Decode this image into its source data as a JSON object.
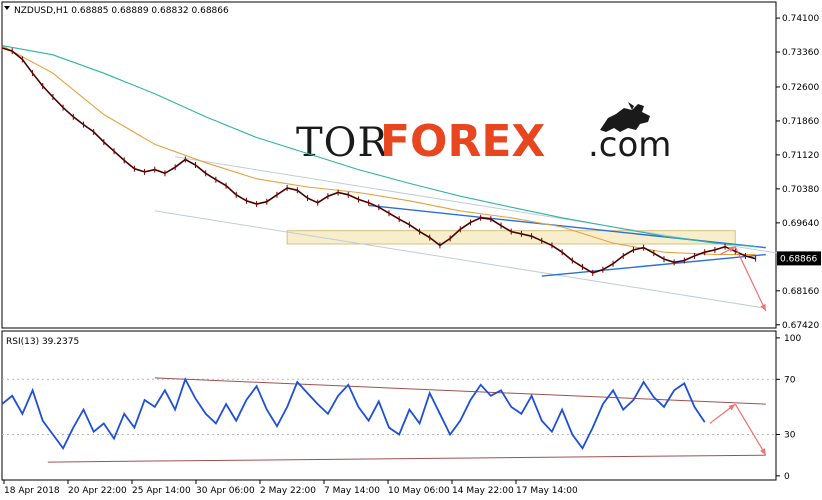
{
  "chart_data": [
    {
      "type": "line",
      "title": "NZDUSD,H1  0.68885 0.68889 0.68832 0.68866",
      "y_ticks": [
        "0.74100",
        "0.73360",
        "0.72600",
        "0.71860",
        "0.71120",
        "0.70380",
        "0.69640",
        "0.68866",
        "0.68160",
        "0.67420"
      ],
      "ylim": [
        0.6735,
        0.7445
      ],
      "current_price": "0.68866",
      "x_labels": [
        "18 Apr 2018",
        "20 Apr 22:00",
        "25 Apr 14:00",
        "30 Apr 06:00",
        "2 May 22:00",
        "7 May 14:00",
        "10 May 06:00",
        "14 May 22:00",
        "17 May 14:00"
      ],
      "price_series": {
        "t": [
          0,
          2,
          4,
          6,
          8,
          10,
          12,
          14,
          16,
          18,
          20,
          22,
          24,
          26,
          28,
          30,
          32,
          34,
          36,
          38,
          40,
          42,
          44,
          46,
          48,
          50,
          52,
          54,
          56,
          58,
          60,
          62,
          64,
          66,
          68,
          70,
          72,
          74,
          76,
          78,
          80,
          82,
          84,
          86,
          88,
          90,
          92,
          94,
          96,
          98,
          100,
          102,
          104,
          106,
          108,
          110,
          112,
          114,
          116,
          118,
          120,
          122,
          124,
          126,
          128,
          130,
          132,
          134,
          136,
          138,
          140,
          142,
          144,
          146,
          148
        ],
        "close": [
          0.7345,
          0.7338,
          0.732,
          0.729,
          0.7262,
          0.7238,
          0.7215,
          0.7195,
          0.7178,
          0.7162,
          0.714,
          0.712,
          0.71,
          0.7082,
          0.7075,
          0.708,
          0.7072,
          0.7085,
          0.7102,
          0.709,
          0.7072,
          0.7058,
          0.7045,
          0.7025,
          0.7012,
          0.7005,
          0.701,
          0.7025,
          0.704,
          0.7035,
          0.7018,
          0.7008,
          0.7022,
          0.703,
          0.7025,
          0.7015,
          0.7008,
          0.6998,
          0.6985,
          0.6972,
          0.696,
          0.6945,
          0.6932,
          0.6915,
          0.693,
          0.695,
          0.6965,
          0.6975,
          0.6972,
          0.6958,
          0.6945,
          0.694,
          0.6935,
          0.6925,
          0.6915,
          0.69,
          0.6882,
          0.6868,
          0.6855,
          0.6862,
          0.6875,
          0.6892,
          0.6905,
          0.691,
          0.6898,
          0.6885,
          0.6878,
          0.6882,
          0.6892,
          0.69,
          0.6905,
          0.6912,
          0.6902,
          0.6892,
          0.6886
        ]
      },
      "moving_averages": [
        {
          "color": "#e6a23c",
          "t": [
            0,
            10,
            20,
            30,
            40,
            50,
            60,
            70,
            80,
            90,
            100,
            110,
            120,
            130,
            140,
            148
          ],
          "values": [
            0.735,
            0.729,
            0.72,
            0.7135,
            0.7095,
            0.706,
            0.7042,
            0.703,
            0.7012,
            0.699,
            0.6975,
            0.6955,
            0.692,
            0.69,
            0.6895,
            0.6895
          ]
        },
        {
          "color": "#2fb5a0",
          "t": [
            0,
            10,
            20,
            30,
            40,
            50,
            60,
            70,
            80,
            90,
            100,
            110,
            120,
            130,
            140,
            148
          ],
          "values": [
            0.735,
            0.733,
            0.729,
            0.7245,
            0.7195,
            0.715,
            0.7115,
            0.708,
            0.705,
            0.7022,
            0.6998,
            0.6975,
            0.6955,
            0.6935,
            0.692,
            0.6912
          ]
        }
      ],
      "lines": [
        {
          "color": "#c0ccd8",
          "t": [
            34,
            154
          ],
          "values": [
            0.7108,
            0.6895
          ]
        },
        {
          "color": "#c0ccd8",
          "t": [
            30,
            150
          ],
          "values": [
            0.699,
            0.6778
          ]
        },
        {
          "color": "#2a6fdb",
          "t": [
            72,
            150
          ],
          "values": [
            0.7002,
            0.691
          ]
        },
        {
          "color": "#2a6fdb",
          "t": [
            106,
            150
          ],
          "values": [
            0.6848,
            0.6895
          ]
        }
      ],
      "zone": {
        "t": [
          56,
          144
        ],
        "values": [
          0.6947,
          0.6918
        ],
        "color": "#f0e0a0"
      },
      "forecast_arrows": [
        {
          "color": "#f07070",
          "t": [
            141,
            144
          ],
          "values": [
            0.6895,
            0.6912
          ]
        },
        {
          "color": "#f07070",
          "t": [
            144,
            150
          ],
          "values": [
            0.6912,
            0.6772
          ]
        }
      ]
    },
    {
      "type": "line",
      "title": "RSI(13) 39.2375",
      "y_ticks": [
        "100",
        "70",
        "30",
        "0"
      ],
      "ylim": [
        -3,
        105
      ],
      "rsi_series": {
        "t": [
          0,
          2,
          4,
          6,
          8,
          10,
          12,
          14,
          16,
          18,
          20,
          22,
          24,
          26,
          28,
          30,
          32,
          34,
          36,
          38,
          40,
          42,
          44,
          46,
          48,
          50,
          52,
          54,
          56,
          58,
          60,
          62,
          64,
          66,
          68,
          70,
          72,
          74,
          76,
          78,
          80,
          82,
          84,
          86,
          88,
          90,
          92,
          94,
          96,
          98,
          100,
          102,
          104,
          106,
          108,
          110,
          112,
          114,
          116,
          118,
          120,
          122,
          124,
          126,
          128,
          130,
          132,
          134,
          136,
          138
        ],
        "values": [
          52,
          58,
          45,
          62,
          40,
          30,
          20,
          35,
          48,
          32,
          38,
          27,
          45,
          35,
          55,
          50,
          62,
          48,
          70,
          56,
          45,
          38,
          52,
          40,
          55,
          65,
          48,
          36,
          50,
          68,
          60,
          52,
          45,
          58,
          66,
          50,
          40,
          54,
          35,
          30,
          48,
          38,
          60,
          45,
          30,
          40,
          55,
          66,
          58,
          62,
          50,
          45,
          58,
          40,
          32,
          48,
          30,
          20,
          35,
          52,
          62,
          48,
          55,
          68,
          57,
          50,
          62,
          67,
          50,
          39
        ]
      },
      "lines": [
        {
          "color": "#a05050",
          "t": [
            30,
            150
          ],
          "values": [
            71,
            52
          ]
        },
        {
          "color": "#a05050",
          "t": [
            9,
            150
          ],
          "values": [
            10,
            15
          ]
        }
      ],
      "forecast_arrows": [
        {
          "color": "#f07070",
          "t": [
            139,
            144
          ],
          "values": [
            38,
            52
          ]
        },
        {
          "color": "#f07070",
          "t": [
            144,
            150
          ],
          "values": [
            52,
            15
          ]
        }
      ]
    }
  ],
  "logo": {
    "tor": "TOR",
    "forex": "FOREX",
    "com": ".com"
  }
}
